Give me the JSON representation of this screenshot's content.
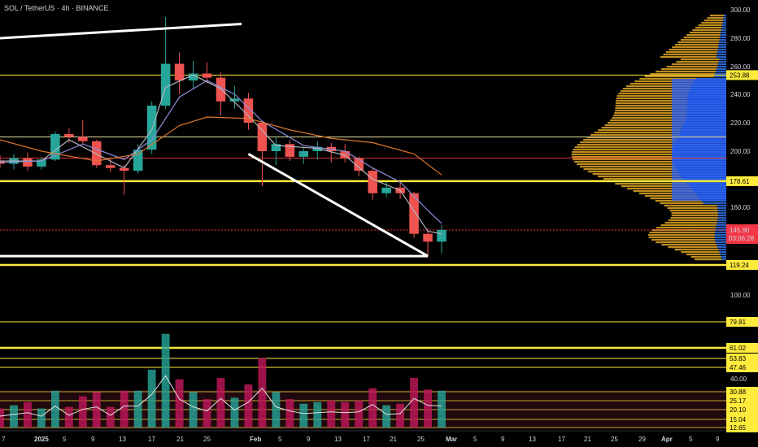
{
  "header": {
    "title": "SOL / TetherUS · 4h · BINANCE"
  },
  "chart_data": {
    "type": "candlestick",
    "symbol": "SOL / TetherUS",
    "interval": "4h",
    "exchange": "BINANCE",
    "price_axis": {
      "ticks": [
        "300.00",
        "280.00",
        "260.00",
        "240.00",
        "220.00",
        "200.00",
        "160.00",
        "100.00",
        "40.00"
      ],
      "price_ticks": [
        300,
        280,
        260,
        240,
        220,
        200,
        160,
        100
      ],
      "low_ticks": [
        40
      ]
    },
    "time_axis": [
      "7",
      "2025",
      "5",
      "9",
      "13",
      "17",
      "21",
      "25",
      "Feb",
      "5",
      "9",
      "13",
      "17",
      "21",
      "25",
      "Mar",
      "5",
      "9",
      "13",
      "17",
      "21",
      "25",
      "29",
      "Apr",
      "5",
      "9"
    ],
    "price_tags": [
      {
        "label": "253.88",
        "value": 253.88,
        "kind": "price",
        "style": "thin"
      },
      {
        "label": "178.61",
        "value": 178.61,
        "kind": "price",
        "style": "thick"
      },
      {
        "label": "119.24",
        "value": 119.24,
        "kind": "price",
        "style": "thick"
      },
      {
        "label": "79.81",
        "value": 79.81,
        "kind": "low",
        "style": "thin"
      },
      {
        "label": "61.02",
        "value": 61.02,
        "kind": "low",
        "style": "thick"
      },
      {
        "label": "53.83",
        "value": 53.83,
        "kind": "low",
        "style": "thin"
      },
      {
        "label": "47.46",
        "value": 47.46,
        "kind": "low",
        "style": "thin"
      },
      {
        "label": "30.88",
        "value": 30.88,
        "kind": "low",
        "style": "thin"
      },
      {
        "label": "25.17",
        "value": 25.17,
        "kind": "low",
        "style": "thin"
      },
      {
        "label": "20.10",
        "value": 20.1,
        "kind": "low",
        "style": "thin"
      },
      {
        "label": "15.04",
        "value": 15.04,
        "kind": "low",
        "style": "thin"
      },
      {
        "label": "12.65",
        "value": 12.65,
        "kind": "low",
        "style": "thin"
      }
    ],
    "last_price": {
      "label": "145.90",
      "countdown": "03:06:28",
      "value": 145.9
    },
    "horizontal_levels_extra": [
      {
        "value": 210,
        "color": "#e8e0a0"
      },
      {
        "value": 195,
        "color": "#d9363e"
      }
    ],
    "trend_lines": [
      {
        "from": {
          "date": "2024-12-26",
          "price": 280
        },
        "to": {
          "date": "2025-01-30",
          "price": 290
        }
      },
      {
        "from": {
          "date": "2025-01-31",
          "price": 198
        },
        "to": {
          "date": "2025-02-26",
          "price": 126
        }
      },
      {
        "from": {
          "date": "2024-12-26",
          "price": 126
        },
        "to": {
          "date": "2025-02-26",
          "price": 126
        }
      }
    ],
    "ohlc": [
      {
        "date": "2024-12-26",
        "o": 193,
        "h": 197,
        "l": 188,
        "c": 191
      },
      {
        "date": "2024-12-28",
        "o": 191,
        "h": 198,
        "l": 187,
        "c": 195
      },
      {
        "date": "2024-12-30",
        "o": 195,
        "h": 199,
        "l": 186,
        "c": 189
      },
      {
        "date": "2025-01-01",
        "o": 189,
        "h": 196,
        "l": 187,
        "c": 194
      },
      {
        "date": "2025-01-03",
        "o": 194,
        "h": 214,
        "l": 193,
        "c": 212
      },
      {
        "date": "2025-01-05",
        "o": 212,
        "h": 216,
        "l": 206,
        "c": 210
      },
      {
        "date": "2025-01-07",
        "o": 210,
        "h": 222,
        "l": 205,
        "c": 207
      },
      {
        "date": "2025-01-09",
        "o": 207,
        "h": 208,
        "l": 188,
        "c": 190
      },
      {
        "date": "2025-01-11",
        "o": 190,
        "h": 195,
        "l": 185,
        "c": 188
      },
      {
        "date": "2025-01-13",
        "o": 188,
        "h": 190,
        "l": 169,
        "c": 186
      },
      {
        "date": "2025-01-15",
        "o": 186,
        "h": 205,
        "l": 184,
        "c": 201
      },
      {
        "date": "2025-01-17",
        "o": 201,
        "h": 235,
        "l": 198,
        "c": 232
      },
      {
        "date": "2025-01-19",
        "o": 232,
        "h": 295,
        "l": 230,
        "c": 262
      },
      {
        "date": "2025-01-21",
        "o": 262,
        "h": 270,
        "l": 240,
        "c": 250
      },
      {
        "date": "2025-01-23",
        "o": 250,
        "h": 264,
        "l": 244,
        "c": 255
      },
      {
        "date": "2025-01-25",
        "o": 255,
        "h": 263,
        "l": 248,
        "c": 252
      },
      {
        "date": "2025-01-27",
        "o": 252,
        "h": 256,
        "l": 225,
        "c": 235
      },
      {
        "date": "2025-01-29",
        "o": 235,
        "h": 246,
        "l": 230,
        "c": 237
      },
      {
        "date": "2025-01-31",
        "o": 237,
        "h": 241,
        "l": 215,
        "c": 220
      },
      {
        "date": "2025-02-02",
        "o": 220,
        "h": 221,
        "l": 175,
        "c": 200
      },
      {
        "date": "2025-02-04",
        "o": 200,
        "h": 210,
        "l": 190,
        "c": 205
      },
      {
        "date": "2025-02-06",
        "o": 205,
        "h": 208,
        "l": 193,
        "c": 196
      },
      {
        "date": "2025-02-08",
        "o": 196,
        "h": 203,
        "l": 191,
        "c": 200
      },
      {
        "date": "2025-02-10",
        "o": 200,
        "h": 207,
        "l": 194,
        "c": 203
      },
      {
        "date": "2025-02-12",
        "o": 203,
        "h": 206,
        "l": 192,
        "c": 200
      },
      {
        "date": "2025-02-14",
        "o": 200,
        "h": 205,
        "l": 192,
        "c": 195
      },
      {
        "date": "2025-02-16",
        "o": 195,
        "h": 196,
        "l": 182,
        "c": 186
      },
      {
        "date": "2025-02-18",
        "o": 186,
        "h": 188,
        "l": 165,
        "c": 170
      },
      {
        "date": "2025-02-20",
        "o": 170,
        "h": 178,
        "l": 167,
        "c": 174
      },
      {
        "date": "2025-02-22",
        "o": 174,
        "h": 178,
        "l": 166,
        "c": 170
      },
      {
        "date": "2025-02-24",
        "o": 170,
        "h": 171,
        "l": 140,
        "c": 143
      },
      {
        "date": "2025-02-26",
        "o": 143,
        "h": 147,
        "l": 125,
        "c": 137
      },
      {
        "date": "2025-02-28",
        "o": 137,
        "h": 149,
        "l": 128,
        "c": 145.9
      }
    ],
    "ema_fast": [
      [
        "2024-12-26",
        193
      ],
      [
        "2025-01-01",
        193
      ],
      [
        "2025-01-05",
        208
      ],
      [
        "2025-01-09",
        198
      ],
      [
        "2025-01-13",
        188
      ],
      [
        "2025-01-17",
        215
      ],
      [
        "2025-01-19",
        245
      ],
      [
        "2025-01-23",
        254
      ],
      [
        "2025-01-27",
        244
      ],
      [
        "2025-01-31",
        225
      ],
      [
        "2025-02-04",
        204
      ],
      [
        "2025-02-10",
        202
      ],
      [
        "2025-02-14",
        197
      ],
      [
        "2025-02-18",
        180
      ],
      [
        "2025-02-22",
        172
      ],
      [
        "2025-02-26",
        145
      ],
      [
        "2025-02-28",
        143
      ]
    ],
    "ema_mid": [
      [
        "2024-12-26",
        192
      ],
      [
        "2025-01-01",
        193
      ],
      [
        "2025-01-07",
        205
      ],
      [
        "2025-01-13",
        194
      ],
      [
        "2025-01-17",
        208
      ],
      [
        "2025-01-21",
        238
      ],
      [
        "2025-01-25",
        250
      ],
      [
        "2025-01-29",
        240
      ],
      [
        "2025-02-02",
        221
      ],
      [
        "2025-02-08",
        204
      ],
      [
        "2025-02-14",
        200
      ],
      [
        "2025-02-18",
        188
      ],
      [
        "2025-02-22",
        178
      ],
      [
        "2025-02-26",
        158
      ],
      [
        "2025-02-28",
        150
      ]
    ],
    "sma_slow": [
      [
        "2024-12-26",
        208
      ],
      [
        "2025-01-01",
        200
      ],
      [
        "2025-01-09",
        193
      ],
      [
        "2025-01-15",
        198
      ],
      [
        "2025-01-21",
        218
      ],
      [
        "2025-01-25",
        224
      ],
      [
        "2025-01-31",
        223
      ],
      [
        "2025-02-06",
        215
      ],
      [
        "2025-02-12",
        209
      ],
      [
        "2025-02-18",
        206
      ],
      [
        "2025-02-24",
        198
      ],
      [
        "2025-02-28",
        183
      ]
    ]
  }
}
